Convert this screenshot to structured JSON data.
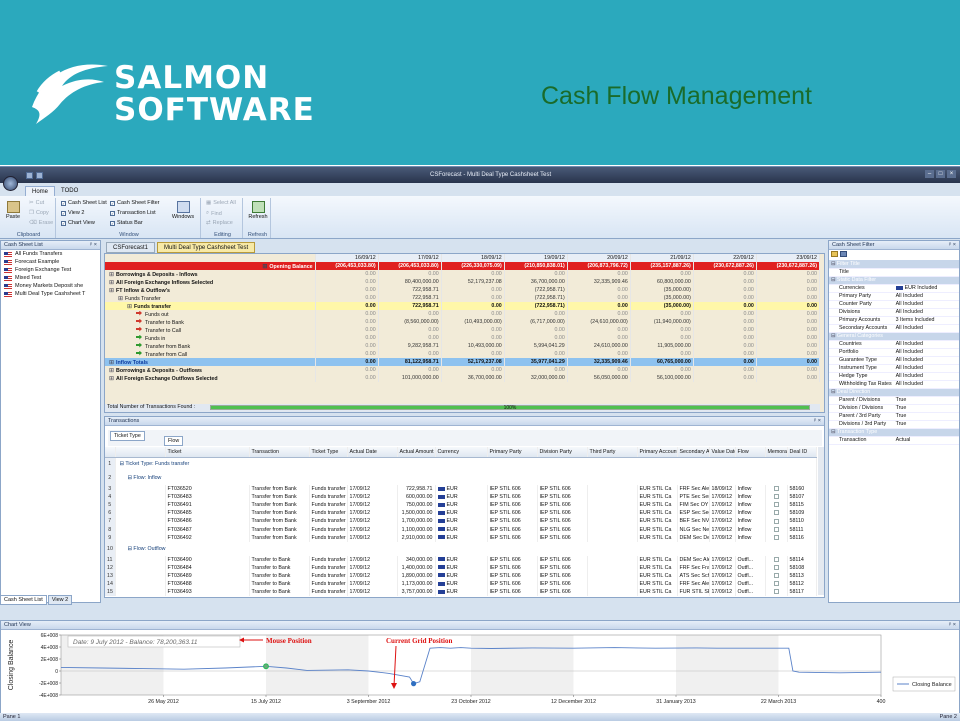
{
  "slide": {
    "logo_line1": "SALMON",
    "logo_line2": "SOFTWARE",
    "title": "Cash Flow Management"
  },
  "window": {
    "title": "CSForecast - Multi Deal Type Cashsheet Test",
    "tabs": [
      "Home",
      "TODO"
    ]
  },
  "ribbon": {
    "clipboard": {
      "label": "Clipboard",
      "paste": "Paste",
      "cut": "Cut",
      "copy": "Copy",
      "erase": "Erase"
    },
    "window": {
      "label": "Window",
      "checks": [
        "Cash Sheet List",
        "View 2",
        "Chart View",
        "Cash Sheet Filter",
        "Transaction List",
        "Status Bar"
      ],
      "windows": "Windows"
    },
    "editing": {
      "label": "Editing",
      "select_all": "Select All",
      "find": "Find",
      "replace": "Replace"
    },
    "refresh": {
      "label": "Refresh",
      "button": "Refresh"
    }
  },
  "cash_sheet_list": {
    "title": "Cash Sheet List",
    "items": [
      "All Funds Transfers",
      "Forecast Example",
      "Foreign Exchange Test",
      "Mixed Test",
      "Money Markets Deposit she",
      "Multi Deal Type Cashsheet T"
    ],
    "bottom_tabs": [
      "Cash Sheet List",
      "View 2"
    ]
  },
  "doc_tabs": [
    "CSForecast1",
    "Multi Deal Type Cashsheet Test"
  ],
  "cashsheet": {
    "dates": [
      "16/09/12",
      "17/09/12",
      "18/09/12",
      "19/09/12",
      "20/09/12",
      "21/09/12",
      "22/09/12",
      "23/09/12"
    ],
    "rows": [
      {
        "label": "Opening Balance",
        "indent": 0,
        "type": "neg",
        "values": [
          "(206,453,033.80)",
          "(206,453,033.80)",
          "(226,330,075.09)",
          "(210,850,838.01)",
          "(206,873,796.72)",
          "(235,157,887.26)",
          "(230,672,887.26)",
          "(230,672,887.26)"
        ]
      },
      {
        "label": "Borrowings & Deposits - Inflows",
        "indent": 0,
        "type": "",
        "values": [
          "0.00",
          "0.00",
          "0.00",
          "0.00",
          "0.00",
          "0.00",
          "0.00",
          "0.00"
        ]
      },
      {
        "label": "All Foreign Exchange Inflows Selected",
        "indent": 0,
        "type": "",
        "values": [
          "0.00",
          "80,400,000.00",
          "52,179,237.08",
          "36,700,000.00",
          "32,335,909.46",
          "60,800,000.00",
          "0.00",
          "0.00"
        ]
      },
      {
        "label": "FT Inflow & Outflow's",
        "indent": 0,
        "type": "",
        "values": [
          "0.00",
          "722,958.71",
          "0.00",
          "(722,958.71)",
          "0.00",
          "(35,000.00)",
          "0.00",
          "0.00"
        ]
      },
      {
        "label": "Funds Transfer",
        "indent": 1,
        "type": "",
        "values": [
          "0.00",
          "722,958.71",
          "0.00",
          "(722,958.71)",
          "0.00",
          "(35,000.00)",
          "0.00",
          "0.00"
        ]
      },
      {
        "label": "Funds transfer",
        "indent": 2,
        "type": "ylw",
        "values": [
          "0.00",
          "722,958.71",
          "0.00",
          "(722,958.71)",
          "0.00",
          "(35,000.00)",
          "0.00",
          "0.00"
        ]
      },
      {
        "label": "Funds out",
        "indent": 3,
        "type": "",
        "values": [
          "0.00",
          "0.00",
          "0.00",
          "0.00",
          "0.00",
          "0.00",
          "0.00",
          "0.00"
        ]
      },
      {
        "label": "Transfer to Bank",
        "indent": 3,
        "type": "",
        "values": [
          "0.00",
          "(8,560,000.00)",
          "(10,493,000.00)",
          "(6,717,000.00)",
          "(24,610,000.00)",
          "(11,940,000.00)",
          "0.00",
          "0.00"
        ]
      },
      {
        "label": "Transfer to Call",
        "indent": 3,
        "type": "",
        "values": [
          "0.00",
          "0.00",
          "0.00",
          "0.00",
          "0.00",
          "0.00",
          "0.00",
          "0.00"
        ]
      },
      {
        "label": "Funds in",
        "indent": 3,
        "type": "",
        "values": [
          "0.00",
          "0.00",
          "0.00",
          "0.00",
          "0.00",
          "0.00",
          "0.00",
          "0.00"
        ]
      },
      {
        "label": "Transfer from Bank",
        "indent": 3,
        "type": "",
        "values": [
          "0.00",
          "9,282,958.71",
          "10,493,000.00",
          "5,994,041.29",
          "24,610,000.00",
          "11,905,000.00",
          "0.00",
          "0.00"
        ]
      },
      {
        "label": "Transfer from Call",
        "indent": 3,
        "type": "",
        "values": [
          "0.00",
          "0.00",
          "0.00",
          "0.00",
          "0.00",
          "0.00",
          "0.00",
          "0.00"
        ]
      },
      {
        "label": "Inflow Totals",
        "indent": 0,
        "type": "blue",
        "values": [
          "0.00",
          "81,122,958.71",
          "52,179,237.08",
          "35,977,041.29",
          "32,335,909.46",
          "60,765,000.00",
          "0.00",
          "0.00"
        ]
      },
      {
        "label": "Borrowings & Deposits - Outflows",
        "indent": 0,
        "type": "",
        "values": [
          "0.00",
          "0.00",
          "0.00",
          "0.00",
          "0.00",
          "0.00",
          "0.00",
          "0.00"
        ]
      },
      {
        "label": "All Foreign Exchange Outflows Selected",
        "indent": 0,
        "type": "",
        "values": [
          "0.00",
          "101,000,000.00",
          "36,700,000.00",
          "32,000,000.00",
          "56,050,000.00",
          "56,100,000.00",
          "0.00",
          "0.00"
        ]
      }
    ],
    "found_label": "Total Number of Transactions Found :",
    "progress_label": "100%",
    "progress": 1.0
  },
  "transactions": {
    "title": "Transactions",
    "group_chips": [
      "Ticket Type",
      "Flow"
    ],
    "columns": [
      "Ticket",
      "Transaction",
      "Ticket Type",
      "Actual Date",
      "Actual Amount",
      "Currency",
      "Primary Party",
      "Division Party",
      "Third Party",
      "Primary Account",
      "Secondary Acco...",
      "Value Date",
      "Flow",
      "Memorandum",
      "Deal ID"
    ],
    "rows": [
      {
        "n": "1",
        "group": "Ticket Type: Funds transfer"
      },
      {
        "n": "2",
        "group": "Flow: Inflow"
      },
      {
        "n": "3",
        "cells": [
          "FT036520",
          "Transfer from Bank",
          "Funds transfer",
          "17/09/12",
          "722,958.71",
          "EUR",
          "IEP STIL 606",
          "IEP STIL 606",
          "",
          "EUR STIL Ca",
          "FRF Sec Alert Se",
          "18/09/12",
          "Inflow",
          "",
          "58160"
        ]
      },
      {
        "n": "4",
        "cells": [
          "FT036483",
          "Transfer from Bank",
          "Funds transfer",
          "17/09/12",
          "600,000.00",
          "EUR",
          "IEP STIL 606",
          "IEP STIL 606",
          "",
          "EUR STIL Ca",
          "PTE Sec Serv e",
          "17/09/12",
          "Inflow",
          "",
          "58107"
        ]
      },
      {
        "n": "5",
        "cells": [
          "FT036491",
          "Transfer from Bank",
          "Funds transfer",
          "17/09/12",
          "750,000.00",
          "EUR",
          "IEP STIL 606",
          "IEP STIL 606",
          "",
          "EUR STIL Ca",
          "FIM Sec OY 396",
          "17/09/12",
          "Inflow",
          "",
          "58115"
        ]
      },
      {
        "n": "6",
        "cells": [
          "FT036485",
          "Transfer from Bank",
          "Funds transfer",
          "17/09/12",
          "1,500,000.00",
          "EUR",
          "IEP STIL 606",
          "IEP STIL 606",
          "",
          "EUR STIL Ca",
          "ESP Sec Seg Es",
          "17/09/12",
          "Inflow",
          "",
          "58109"
        ]
      },
      {
        "n": "7",
        "cells": [
          "FT036486",
          "Transfer from Bank",
          "Funds transfer",
          "17/09/12",
          "1,700,000.00",
          "EUR",
          "IEP STIL 606",
          "IEP STIL 606",
          "",
          "EUR STIL Ca",
          "BEF Sec NV 556",
          "17/09/12",
          "Inflow",
          "",
          "58110"
        ]
      },
      {
        "n": "8",
        "cells": [
          "FT036487",
          "Transfer from Bank",
          "Funds transfer",
          "17/09/12",
          "1,100,000.00",
          "EUR",
          "IEP STIL 606",
          "IEP STIL 606",
          "",
          "EUR STIL Ca",
          "NLG Sec Nederl",
          "17/09/12",
          "Inflow",
          "",
          "58111"
        ]
      },
      {
        "n": "9",
        "cells": [
          "FT036492",
          "Transfer from Bank",
          "Funds transfer",
          "17/09/12",
          "2,910,000.00",
          "EUR",
          "IEP STIL 606",
          "IEP STIL 606",
          "",
          "EUR STIL Ca",
          "DEM Sec Deu H",
          "17/09/12",
          "Inflow",
          "",
          "58116"
        ]
      },
      {
        "n": "10",
        "group": "Flow: Outflow"
      },
      {
        "n": "11",
        "cells": [
          "FT036490",
          "Transfer to Bank",
          "Funds transfer",
          "17/09/12",
          "340,000.00",
          "EUR",
          "IEP STIL 606",
          "IEP STIL 606",
          "",
          "EUR STIL Ca",
          "DEM Sec Alert S",
          "17/09/12",
          "Outfl...",
          "",
          "58114"
        ]
      },
      {
        "n": "12",
        "cells": [
          "FT036484",
          "Transfer to Bank",
          "Funds transfer",
          "17/09/12",
          "1,400,000.00",
          "EUR",
          "IEP STIL 606",
          "IEP STIL 606",
          "",
          "EUR STIL Ca",
          "FRF Sec France",
          "17/09/12",
          "Outfl...",
          "",
          "58108"
        ]
      },
      {
        "n": "13",
        "cells": [
          "FT036489",
          "Transfer to Bank",
          "Funds transfer",
          "17/09/12",
          "1,890,000.00",
          "EUR",
          "IEP STIL 606",
          "IEP STIL 606",
          "",
          "EUR STIL Ca",
          "ATS Sec Sch G",
          "17/09/12",
          "Outfl...",
          "",
          "58113"
        ]
      },
      {
        "n": "14",
        "cells": [
          "FT036488",
          "Transfer to Bank",
          "Funds transfer",
          "17/09/12",
          "1,173,000.00",
          "EUR",
          "IEP STIL 606",
          "IEP STIL 606",
          "",
          "EUR STIL Ca",
          "FRF Sec Alert S",
          "17/09/12",
          "Outfl...",
          "",
          "58112"
        ]
      },
      {
        "n": "15",
        "cells": [
          "FT036493",
          "Transfer to Bank",
          "Funds transfer",
          "17/09/12",
          "3,757,000.00",
          "EUR",
          "IEP STIL 606",
          "IEP STIL 606",
          "",
          "EUR STIL Ca",
          "FUR STIL SER",
          "17/09/12",
          "Outfl...",
          "",
          "58117"
        ]
      }
    ]
  },
  "filter": {
    "title": "Cash Sheet Filter",
    "sections": [
      {
        "name": "Filter Title",
        "rows": [
          [
            "Title",
            ""
          ]
        ]
      },
      {
        "name": "Static Data Filter",
        "rows": [
          [
            "Currencies",
            "EUR Included"
          ],
          [
            "Primary Party",
            "All Included"
          ],
          [
            "Counter Party",
            "All Included"
          ],
          [
            "Divisions",
            "All Included"
          ],
          [
            "Primary Accounts",
            "3 Items Included"
          ],
          [
            "Secondary Accounts",
            "All Included"
          ]
        ]
      },
      {
        "name": "General Categories",
        "rows": [
          [
            "Countries",
            "All Included"
          ],
          [
            "Portfolio",
            "All Included"
          ],
          [
            "Guarantee Type",
            "All Included"
          ],
          [
            "Instrument Type",
            "All Included"
          ],
          [
            "Hedge Type",
            "All Included"
          ],
          [
            "Withholding Tax Rates",
            "All Included"
          ]
        ]
      },
      {
        "name": "Deal Direction",
        "rows": [
          [
            "Parent / Divisions",
            "True"
          ],
          [
            "Division / Divisions",
            "True"
          ],
          [
            "Parent / 3rd Party",
            "True"
          ],
          [
            "Divisions / 3rd Party",
            "True"
          ]
        ]
      },
      {
        "name": "Transaction Type",
        "rows": [
          [
            "Transaction",
            "Actual"
          ]
        ]
      }
    ]
  },
  "chart_view": {
    "title": "Chart View",
    "tooltip": "Date: 9 July 2012 - Balance: 78,200,363.11",
    "annot_mouse": "Mouse Position",
    "annot_grid": "Current Grid Position",
    "legend": "Closing Balance",
    "ylabel": "Closing Balance",
    "status_left": "Pane 1",
    "status_right": "Pane 2"
  },
  "chart_data": {
    "type": "line",
    "ylabel": "Closing Balance",
    "y_ticks": [
      "6E+008",
      "4E+008",
      "2E+008",
      "0",
      "-2E+008",
      "-4E+008"
    ],
    "ylim": [
      -400000000,
      600000000
    ],
    "x_tick_labels": [
      "26 May 2012",
      "15 July 2012",
      "3 September 2012",
      "23 October 2012",
      "12 December 2012",
      "31 January 2013",
      "22 March 2013",
      "400"
    ],
    "x_tick_days": [
      50,
      100,
      150,
      200,
      250,
      300,
      350,
      400
    ],
    "xlim": [
      0,
      400
    ],
    "series": [
      {
        "name": "Closing Balance",
        "x": [
          0,
          20,
          40,
          60,
          80,
          100,
          110,
          120,
          140,
          150,
          160,
          170,
          172,
          175,
          180,
          185,
          190,
          195,
          200,
          210,
          230,
          250,
          270,
          290,
          310,
          320,
          340,
          355,
          357,
          360,
          380,
          400
        ],
        "y": [
          60000000,
          50000000,
          40000000,
          30000000,
          50000000,
          78200363,
          50000000,
          10000000,
          20000000,
          0,
          -40000000,
          -100000000,
          -210000000,
          -180000000,
          380000000,
          390000000,
          380000000,
          390000000,
          380000000,
          375000000,
          385000000,
          380000000,
          390000000,
          380000000,
          385000000,
          380000000,
          380000000,
          380000000,
          0,
          -20000000,
          -30000000,
          -20000000
        ]
      }
    ]
  }
}
